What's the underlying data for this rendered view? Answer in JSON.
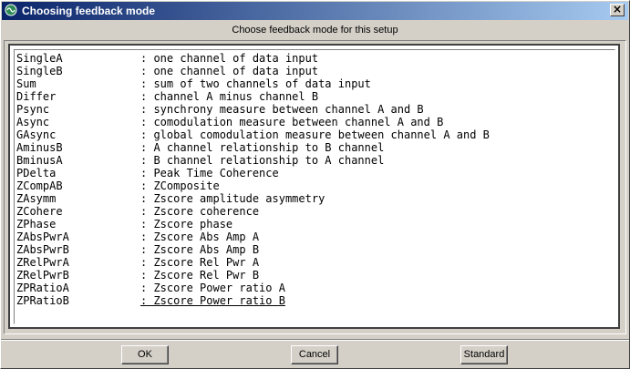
{
  "window": {
    "title": "Choosing feedback mode",
    "close_label": "×"
  },
  "header": {
    "subtitle": "Choose feedback mode for this setup"
  },
  "modes": [
    {
      "code": "SingleA",
      "desc": ": one channel of data input"
    },
    {
      "code": "SingleB",
      "desc": ": one channel of data input"
    },
    {
      "code": "Sum",
      "desc": ": sum of two channels of data input"
    },
    {
      "code": "Differ",
      "desc": ": channel A minus channel B"
    },
    {
      "code": "Psync",
      "desc": ": synchrony measure between channel A and B"
    },
    {
      "code": "Async",
      "desc": ": comodulation measure between channel A and B"
    },
    {
      "code": "GAsync",
      "desc": ": global comodulation measure between channel A and B"
    },
    {
      "code": "AminusB",
      "desc": ": A channel relationship to B channel"
    },
    {
      "code": "BminusA",
      "desc": ": B channel relationship to A channel"
    },
    {
      "code": "PDelta",
      "desc": ": Peak Time Coherence"
    },
    {
      "code": "ZCompAB",
      "desc": ": ZComposite"
    },
    {
      "code": "ZAsymm",
      "desc": ": Zscore amplitude asymmetry"
    },
    {
      "code": "ZCohere",
      "desc": ": Zscore coherence"
    },
    {
      "code": "ZPhase",
      "desc": ": Zscore phase"
    },
    {
      "code": "ZAbsPwrA",
      "desc": ": Zscore Abs Amp A"
    },
    {
      "code": "ZAbsPwrB",
      "desc": ": Zscore Abs Amp B"
    },
    {
      "code": "ZRelPwrA",
      "desc": ": Zscore Rel Pwr A"
    },
    {
      "code": "ZRelPwrB",
      "desc": ": Zscore Rel Pwr B"
    },
    {
      "code": "ZPRatioA",
      "desc": ": Zscore Power ratio A"
    },
    {
      "code": "ZPRatioB",
      "desc": ": Zscore Power ratio B"
    }
  ],
  "buttons": {
    "ok": "OK",
    "cancel": "Cancel",
    "standard": "Standard"
  }
}
